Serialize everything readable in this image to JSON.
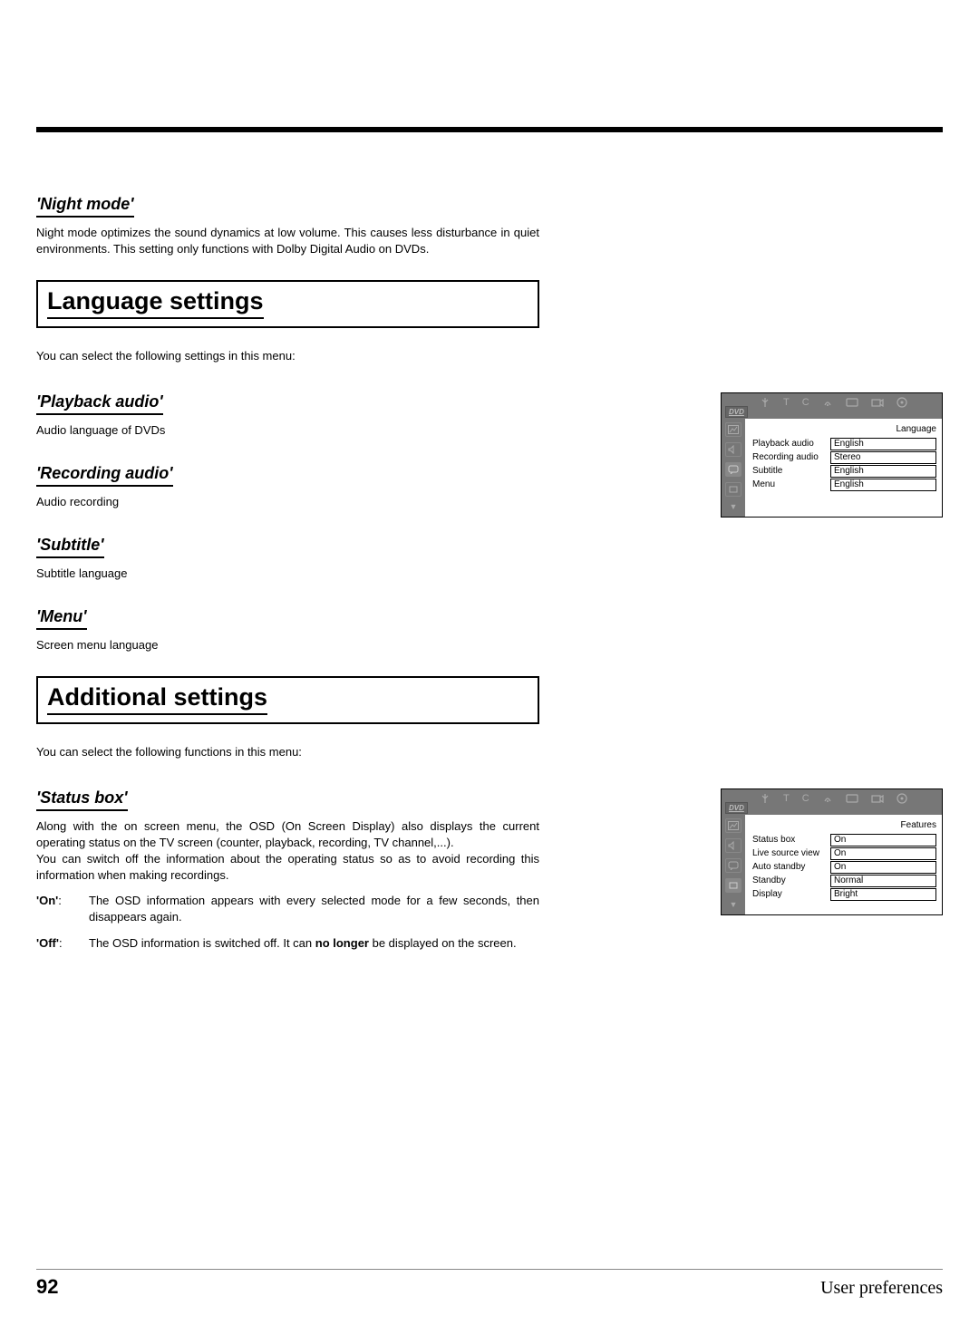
{
  "sections": {
    "night_mode": {
      "heading": "'Night mode'",
      "body": "Night mode optimizes the sound dynamics at low volume. This causes less disturbance in quiet environments. This setting only functions with Dolby Digital Audio on DVDs."
    },
    "language_settings": {
      "heading": "Language settings",
      "intro": "You can select the following settings in this menu:",
      "items": {
        "playback_audio": {
          "heading": "'Playback audio'",
          "body": "Audio language of DVDs"
        },
        "recording_audio": {
          "heading": "'Recording audio'",
          "body": "Audio recording"
        },
        "subtitle": {
          "heading": "'Subtitle'",
          "body": "Subtitle language"
        },
        "menu": {
          "heading": "'Menu'",
          "body": "Screen menu language"
        }
      }
    },
    "additional_settings": {
      "heading": "Additional settings",
      "intro": "You can select the following functions in this menu:",
      "status_box": {
        "heading": "'Status box'",
        "body1": "Along with the on screen menu, the OSD (On Screen Display) also displays the current operating status on the TV screen (counter, playback, recording, TV channel,...).",
        "body2": "You can switch off the information about the operating status so as to avoid recording this information when making recordings.",
        "on_label": "'On'",
        "on_colon": ":",
        "on_body": "The OSD information appears with every selected mode for a few seconds, then disappears again.",
        "off_label": "'Off'",
        "off_colon": ":",
        "off_body_pre": "The OSD information is switched off. It can ",
        "off_body_bold": "no longer",
        "off_body_post": " be displayed on the screen."
      }
    }
  },
  "osd1": {
    "dvd": "DVD",
    "title": "Language",
    "rows": [
      {
        "label": "Playback audio",
        "value": "English"
      },
      {
        "label": "Recording audio",
        "value": "Stereo"
      },
      {
        "label": "Subtitle",
        "value": "English"
      },
      {
        "label": "Menu",
        "value": "English"
      }
    ]
  },
  "osd2": {
    "dvd": "DVD",
    "title": "Features",
    "rows": [
      {
        "label": "Status box",
        "value": "On"
      },
      {
        "label": "Live source view",
        "value": "On"
      },
      {
        "label": "Auto standby",
        "value": "On"
      },
      {
        "label": "Standby",
        "value": "Normal"
      },
      {
        "label": "Display",
        "value": "Bright"
      }
    ]
  },
  "footer": {
    "page": "92",
    "title": "User preferences"
  },
  "chart_data": [
    {
      "type": "table",
      "title": "Language",
      "rows": [
        [
          "Playback audio",
          "English"
        ],
        [
          "Recording audio",
          "Stereo"
        ],
        [
          "Subtitle",
          "English"
        ],
        [
          "Menu",
          "English"
        ]
      ]
    },
    {
      "type": "table",
      "title": "Features",
      "rows": [
        [
          "Status box",
          "On"
        ],
        [
          "Live source view",
          "On"
        ],
        [
          "Auto standby",
          "On"
        ],
        [
          "Standby",
          "Normal"
        ],
        [
          "Display",
          "Bright"
        ]
      ]
    }
  ]
}
